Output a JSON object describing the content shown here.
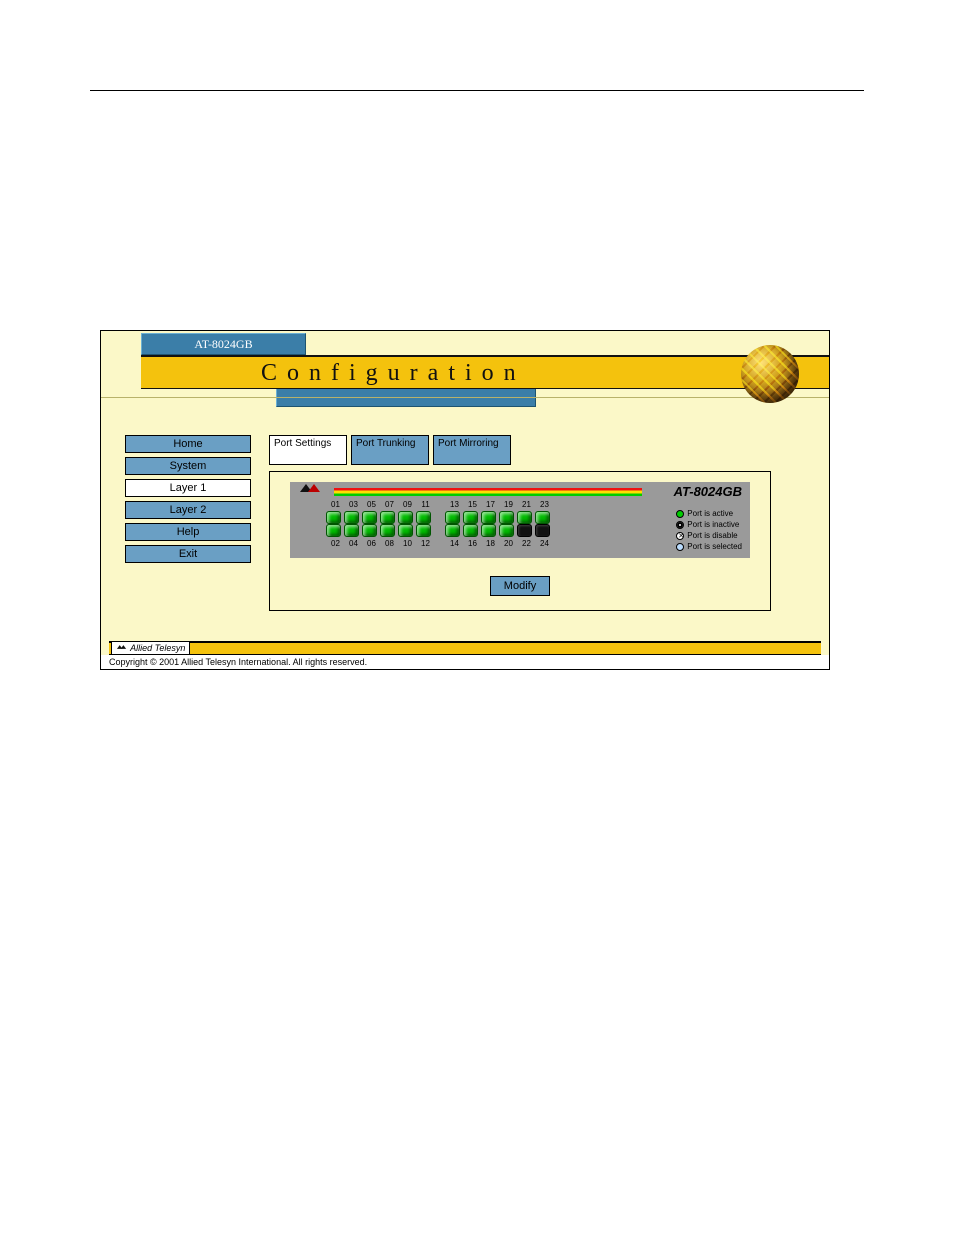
{
  "model": "AT-8024GB",
  "page_title": "Configuration",
  "nav": [
    {
      "label": "Home",
      "active": false
    },
    {
      "label": "System",
      "active": false
    },
    {
      "label": "Layer 1",
      "active": true
    },
    {
      "label": "Layer 2",
      "active": false
    },
    {
      "label": "Help",
      "active": false
    },
    {
      "label": "Exit",
      "active": false
    }
  ],
  "tabs": [
    {
      "label": "Port Settings",
      "active": true
    },
    {
      "label": "Port Trunking",
      "active": false
    },
    {
      "label": "Port Mirroring",
      "active": false
    }
  ],
  "switch": {
    "model_label": "AT-8024GB",
    "top_numbers": [
      "01",
      "03",
      "05",
      "07",
      "09",
      "11",
      "13",
      "15",
      "17",
      "19",
      "21",
      "23"
    ],
    "bottom_numbers": [
      "02",
      "04",
      "06",
      "08",
      "10",
      "12",
      "14",
      "16",
      "18",
      "20",
      "22",
      "24"
    ],
    "top_row_active": [
      true,
      true,
      true,
      true,
      true,
      true,
      true,
      true,
      true,
      true,
      true,
      true
    ],
    "bottom_row_active": [
      true,
      true,
      true,
      true,
      true,
      true,
      true,
      true,
      true,
      true,
      false,
      false
    ]
  },
  "legend": {
    "active": "Port is active",
    "inactive": "Port is inactive",
    "disable": "Port is disable",
    "selected": "Port is selected"
  },
  "modify_label": "Modify",
  "footer_brand": "Allied Telesyn",
  "copyright": "Copyright © 2001 Allied Telesyn International. All rights reserved."
}
